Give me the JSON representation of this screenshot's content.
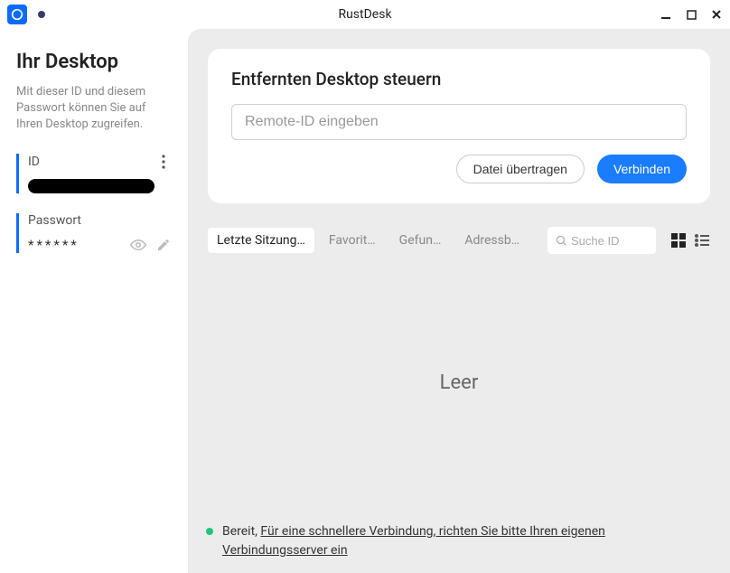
{
  "window": {
    "title": "RustDesk"
  },
  "sidebar": {
    "heading": "Ihr Desktop",
    "desc": "Mit dieser ID und diesem Passwort können Sie auf Ihren Desktop zugreifen.",
    "id_label": "ID",
    "password_label": "Passwort",
    "password_value": "******"
  },
  "connect": {
    "heading": "Entfernten Desktop steuern",
    "placeholder": "Remote-ID eingeben",
    "file_transfer": "Datei übertragen",
    "connect_btn": "Verbinden"
  },
  "tabs": {
    "recent": "Letzte Sitzung…",
    "favorites": "Favorit…",
    "found": "Gefun…",
    "addressbook": "Adressb…"
  },
  "search": {
    "placeholder": "Suche ID"
  },
  "empty": "Leer",
  "status": {
    "ready": "Bereit, ",
    "link": "Für eine schnellere Verbindung, richten Sie bitte Ihren eigenen Verbindungsserver ein"
  }
}
